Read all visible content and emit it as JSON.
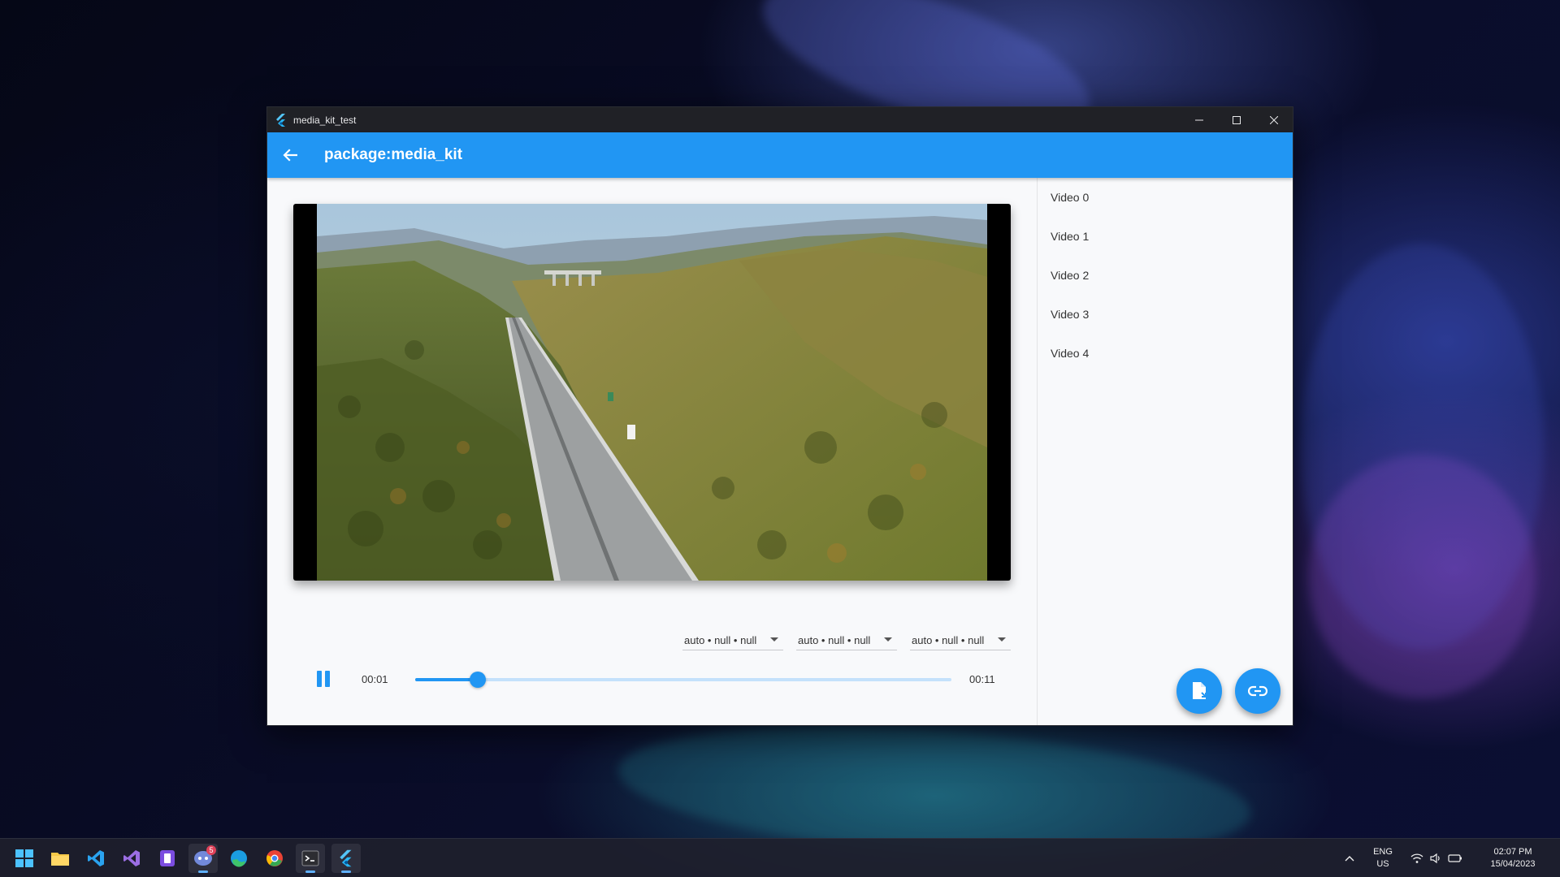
{
  "window": {
    "title": "media_kit_test"
  },
  "appbar": {
    "title": "package:media_kit"
  },
  "player": {
    "tracks": [
      {
        "label": "auto • null • null"
      },
      {
        "label": "auto • null • null"
      },
      {
        "label": "auto • null • null"
      }
    ],
    "position": "00:01",
    "duration": "00:11",
    "progress": 0.117
  },
  "playlist": {
    "items": [
      {
        "label": "Video 0"
      },
      {
        "label": "Video 1"
      },
      {
        "label": "Video 2"
      },
      {
        "label": "Video 3"
      },
      {
        "label": "Video 4"
      }
    ]
  },
  "fabs": [
    {
      "icon": "file-open-icon"
    },
    {
      "icon": "link-icon"
    }
  ],
  "taskbar": {
    "apps": [
      {
        "icon": "windows-start-icon"
      },
      {
        "icon": "file-explorer-icon"
      },
      {
        "icon": "vscode-icon"
      },
      {
        "icon": "visual-studio-icon"
      },
      {
        "icon": "notepad-icon"
      },
      {
        "icon": "discord-icon",
        "badge": "5"
      },
      {
        "icon": "edge-icon"
      },
      {
        "icon": "chrome-icon"
      },
      {
        "icon": "terminal-icon"
      },
      {
        "icon": "flutter-icon"
      }
    ],
    "language": "ENG",
    "region": "US",
    "time": "02:07 PM",
    "date": "15/04/2023"
  },
  "colors": {
    "primary": "#2196f3",
    "slider_track": "#c4e1fb",
    "titlebar": "#202126"
  }
}
